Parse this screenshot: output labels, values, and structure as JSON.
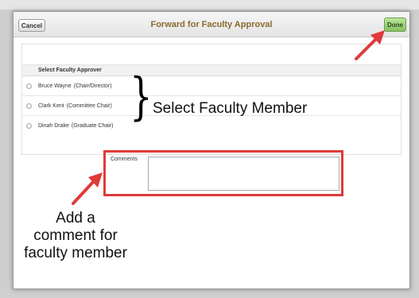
{
  "modal": {
    "cancel_label": "Cancel",
    "title": "Forward for Faculty Approval",
    "done_label": "Done"
  },
  "approvers": {
    "header": "Select Faculty Approver",
    "items": [
      {
        "name": "Bruce Wayne",
        "role": "(Chair/Director)"
      },
      {
        "name": "Clark Kent",
        "role": "(Committee Chair)"
      },
      {
        "name": "Dinah Drake",
        "role": "(Graduate Chair)"
      }
    ]
  },
  "comments": {
    "label": "Comments",
    "value": ""
  },
  "annotations": {
    "select_member": "Select Faculty Member",
    "comment_line1": "Add a",
    "comment_line2": "comment for",
    "comment_line3": "faculty member",
    "highlight_color": "#e03a3a"
  }
}
